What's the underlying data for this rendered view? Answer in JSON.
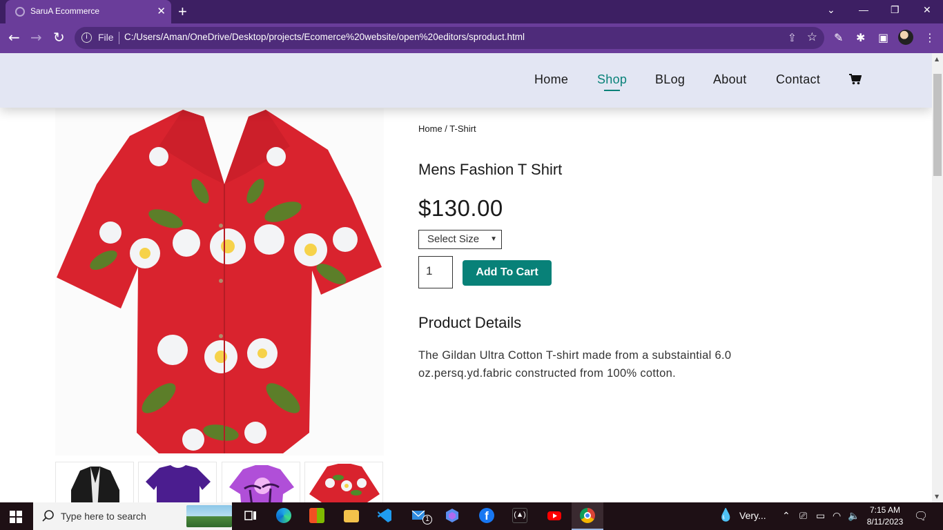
{
  "browser": {
    "tab_title": "SaruA Ecommerce",
    "close_glyph": "✕",
    "new_tab_glyph": "+",
    "file_label": "File",
    "url": "C:/Users/Aman/OneDrive/Desktop/projects/Ecomerce%20website/open%20editors/sproduct.html"
  },
  "nav": {
    "items": [
      {
        "label": "Home",
        "active": false
      },
      {
        "label": "Shop",
        "active": true
      },
      {
        "label": "BLog",
        "active": false
      },
      {
        "label": "About",
        "active": false
      },
      {
        "label": "Contact",
        "active": false
      }
    ],
    "cart_icon": "cart-icon"
  },
  "product": {
    "breadcrumb": "Home / T-Shirt",
    "title": "Mens Fashion T Shirt",
    "price": "$130.00",
    "size_select": "Select Size",
    "quantity": "1",
    "add_to_cart": "Add To Cart",
    "details_heading": "Product Details",
    "details_text": "The Gildan Ultra Cotton T-shirt made from a substaintial 6.0 oz.persq.yd.fabric constructed from 100% cotton."
  },
  "theme": {
    "accent": "#088178",
    "header_bg": "#e3e6f3",
    "browser_bg": "#6a3d9a"
  },
  "taskbar": {
    "search_placeholder": "Type here to search",
    "weather": "Very...",
    "time": "7:15 AM",
    "date": "8/11/2023",
    "mail_badge": "1"
  }
}
